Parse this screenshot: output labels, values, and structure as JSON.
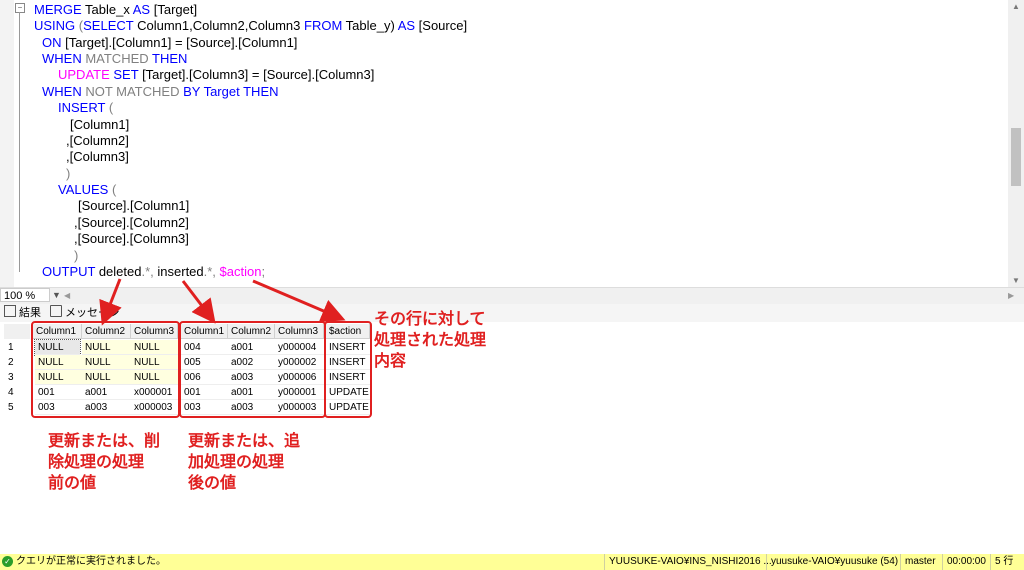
{
  "editor": {
    "lines": {
      "l1": {
        "a": "MERGE",
        "b": " Table_x ",
        "c": "AS",
        "d": " [Target]"
      },
      "l2": {
        "a": "USING",
        "b": " (",
        "c": "SELECT",
        "d": " Column1,Column2,Column3 ",
        "e": "FROM",
        "f": " Table_y) ",
        "g": "AS",
        "h": " [Source]"
      },
      "l3": {
        "a": "ON",
        "b": " [Target].[Column1] = [Source].[Column1]"
      },
      "l4": {
        "a": "WHEN",
        "b": " MATCHED ",
        "c": "THEN"
      },
      "l5": {
        "a": "UPDATE",
        "b": " ",
        "c": "SET",
        "d": " [Target].[Column3] = [Source].[Column3]"
      },
      "l6": {
        "a": "WHEN",
        "b": " NOT MATCHED ",
        "c": "BY",
        "d": " ",
        "e": "Target",
        "f": " ",
        "g": "THEN"
      },
      "l7": {
        "a": "INSERT",
        "b": " ("
      },
      "l8": "[Column1]",
      "l9": ",[Column2]",
      "l10": ",[Column3]",
      "l11": ")",
      "l12": {
        "a": "VALUES",
        "b": " ("
      },
      "l13": "[Source].[Column1]",
      "l14": ",[Source].[Column2]",
      "l15": ",[Source].[Column3]",
      "l16": ")",
      "l17": {
        "a": "OUTPUT",
        "b": " deleted",
        "c": ".*, ",
        "d": "inserted",
        "e": ".*, ",
        "f": "$action",
        "g": ";"
      }
    }
  },
  "zoom": {
    "value": "100 %"
  },
  "tabs": {
    "results": "結果",
    "messages": "メッセージ"
  },
  "grid": {
    "headers": [
      "Column1",
      "Column2",
      "Column3",
      "Column1",
      "Column2",
      "Column3",
      "$action"
    ],
    "rows": [
      {
        "num": "1",
        "cells": [
          "NULL",
          "NULL",
          "NULL",
          "004",
          "a001",
          "y000004",
          "INSERT"
        ]
      },
      {
        "num": "2",
        "cells": [
          "NULL",
          "NULL",
          "NULL",
          "005",
          "a002",
          "y000002",
          "INSERT"
        ]
      },
      {
        "num": "3",
        "cells": [
          "NULL",
          "NULL",
          "NULL",
          "006",
          "a003",
          "y000006",
          "INSERT"
        ]
      },
      {
        "num": "4",
        "cells": [
          "001",
          "a001",
          "x000001",
          "001",
          "a001",
          "y000001",
          "UPDATE"
        ]
      },
      {
        "num": "5",
        "cells": [
          "003",
          "a003",
          "x000003",
          "003",
          "a003",
          "y000003",
          "UPDATE"
        ]
      }
    ]
  },
  "annotations": {
    "deleted_note": "更新または、削\n除処理の処理\n前の値",
    "inserted_note": "更新または、追\n加処理の処理\n後の値",
    "action_note": "その行に対して\n処理された処理\n内容"
  },
  "status": {
    "message": "クエリが正常に実行されました。",
    "server": "YUUSUKE-VAIO¥INS_NISHI2016 ...",
    "user": "yuusuke-VAIO¥yuusuke (54)",
    "database": "master",
    "elapsed": "00:00:00",
    "rows": "5 行"
  },
  "colors": {
    "keyword": "#0000ff",
    "gray": "#808080",
    "pink": "#ff00ff",
    "annotation": "#e02020",
    "status_bg": "#ffff96"
  }
}
